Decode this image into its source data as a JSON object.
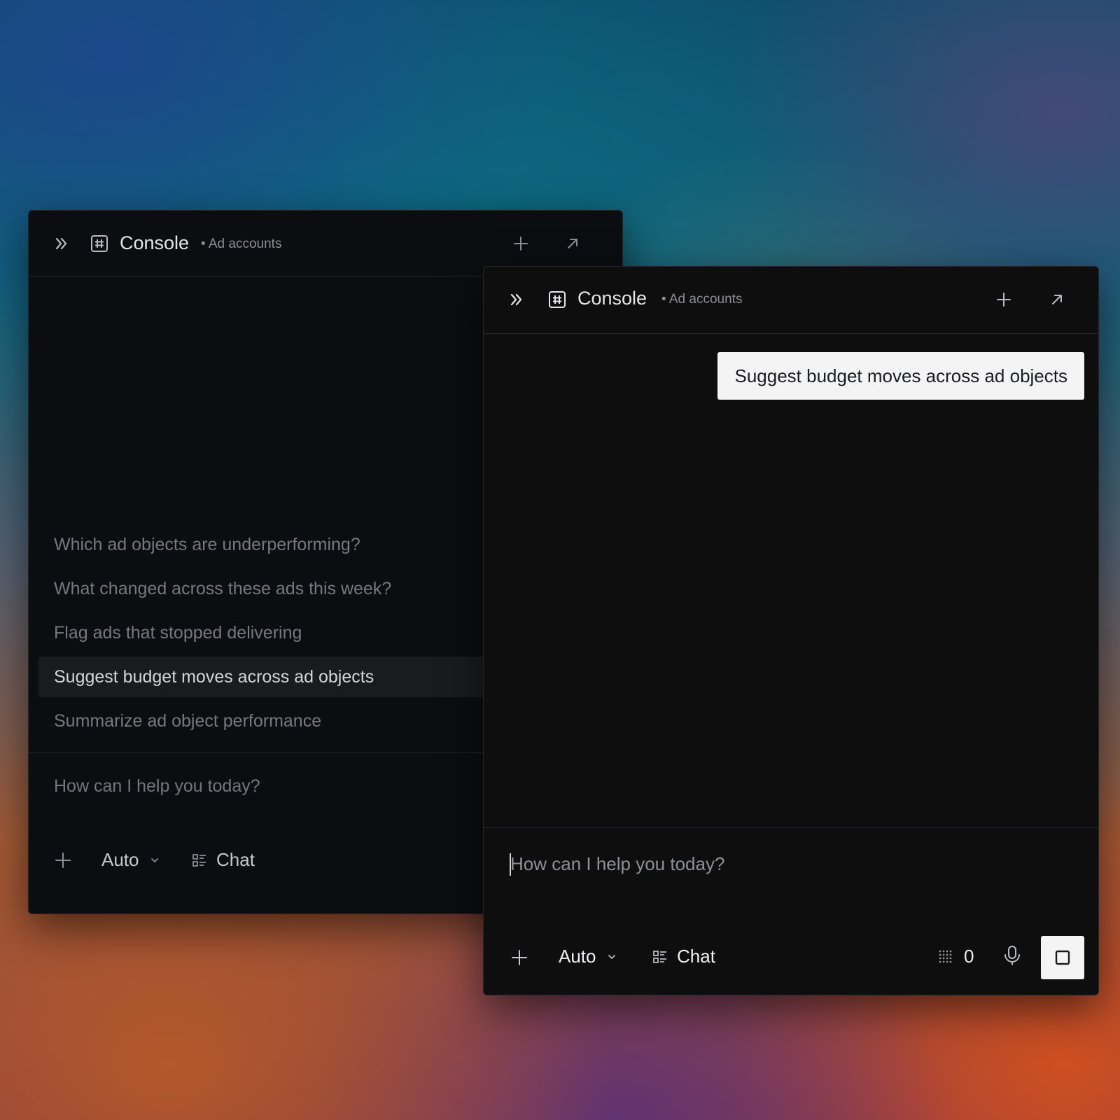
{
  "back_window": {
    "title": "Console",
    "subtitle": "• Ad accounts",
    "suggestions": [
      "Which ad objects are underperforming?",
      "What changed across these ads this week?",
      "Flag ads that stopped delivering",
      "Suggest budget moves across ad objects",
      "Summarize ad object performance"
    ],
    "active_suggestion_index": 3,
    "input_placeholder": "How can I help you today?",
    "model_label": "Auto",
    "mode_label": "Chat"
  },
  "front_window": {
    "title": "Console",
    "subtitle": "• Ad accounts",
    "user_message": "Suggest budget moves across ad objects",
    "input_placeholder": "How can I help you today?",
    "model_label": "Auto",
    "mode_label": "Chat",
    "token_count": "0"
  },
  "icons": {
    "sidebar_toggle": "chevrons-right-icon",
    "workspace": "hash-square-icon",
    "new_chat": "plus-icon",
    "popout": "arrow-up-right-icon",
    "attach": "plus-icon",
    "model_dropdown": "chevron-down-icon",
    "mode": "list-icon",
    "tokens": "grid-dots-icon",
    "voice": "microphone-icon",
    "stop": "stop-square-icon"
  },
  "colors": {
    "window_bg": "#0e0e0f",
    "bubble_bg": "#f4f4f5",
    "text_primary": "#e6e6e8",
    "text_muted": "#76787d"
  }
}
